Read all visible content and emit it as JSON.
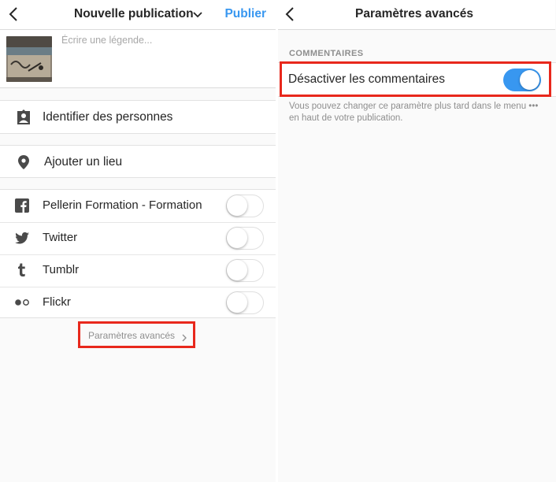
{
  "left": {
    "header": {
      "title": "Nouvelle publication",
      "publish_label": "Publier"
    },
    "caption": {
      "placeholder": "Écrire une légende..."
    },
    "tag_people_label": "Identifier des personnes",
    "add_location_label": "Ajouter un lieu",
    "share_targets": [
      {
        "label": "Pellerin Formation - Formation",
        "icon": "facebook-icon",
        "enabled": false
      },
      {
        "label": "Twitter",
        "icon": "twitter-icon",
        "enabled": false
      },
      {
        "label": "Tumblr",
        "icon": "tumblr-icon",
        "enabled": false
      },
      {
        "label": "Flickr",
        "icon": "flickr-icon",
        "enabled": false
      }
    ],
    "advanced_link_label": "Paramètres avancés"
  },
  "right": {
    "header": {
      "title": "Paramètres avancés"
    },
    "section_title": "COMMENTAIRES",
    "disable_comments": {
      "label": "Désactiver les commentaires",
      "enabled": true
    },
    "help_text": "Vous pouvez changer ce paramètre plus tard dans le menu ••• en haut de votre publication."
  },
  "colors": {
    "accent": "#3897f0",
    "highlight": "#e8281c",
    "text": "#262626",
    "muted": "#8e8e8e"
  }
}
